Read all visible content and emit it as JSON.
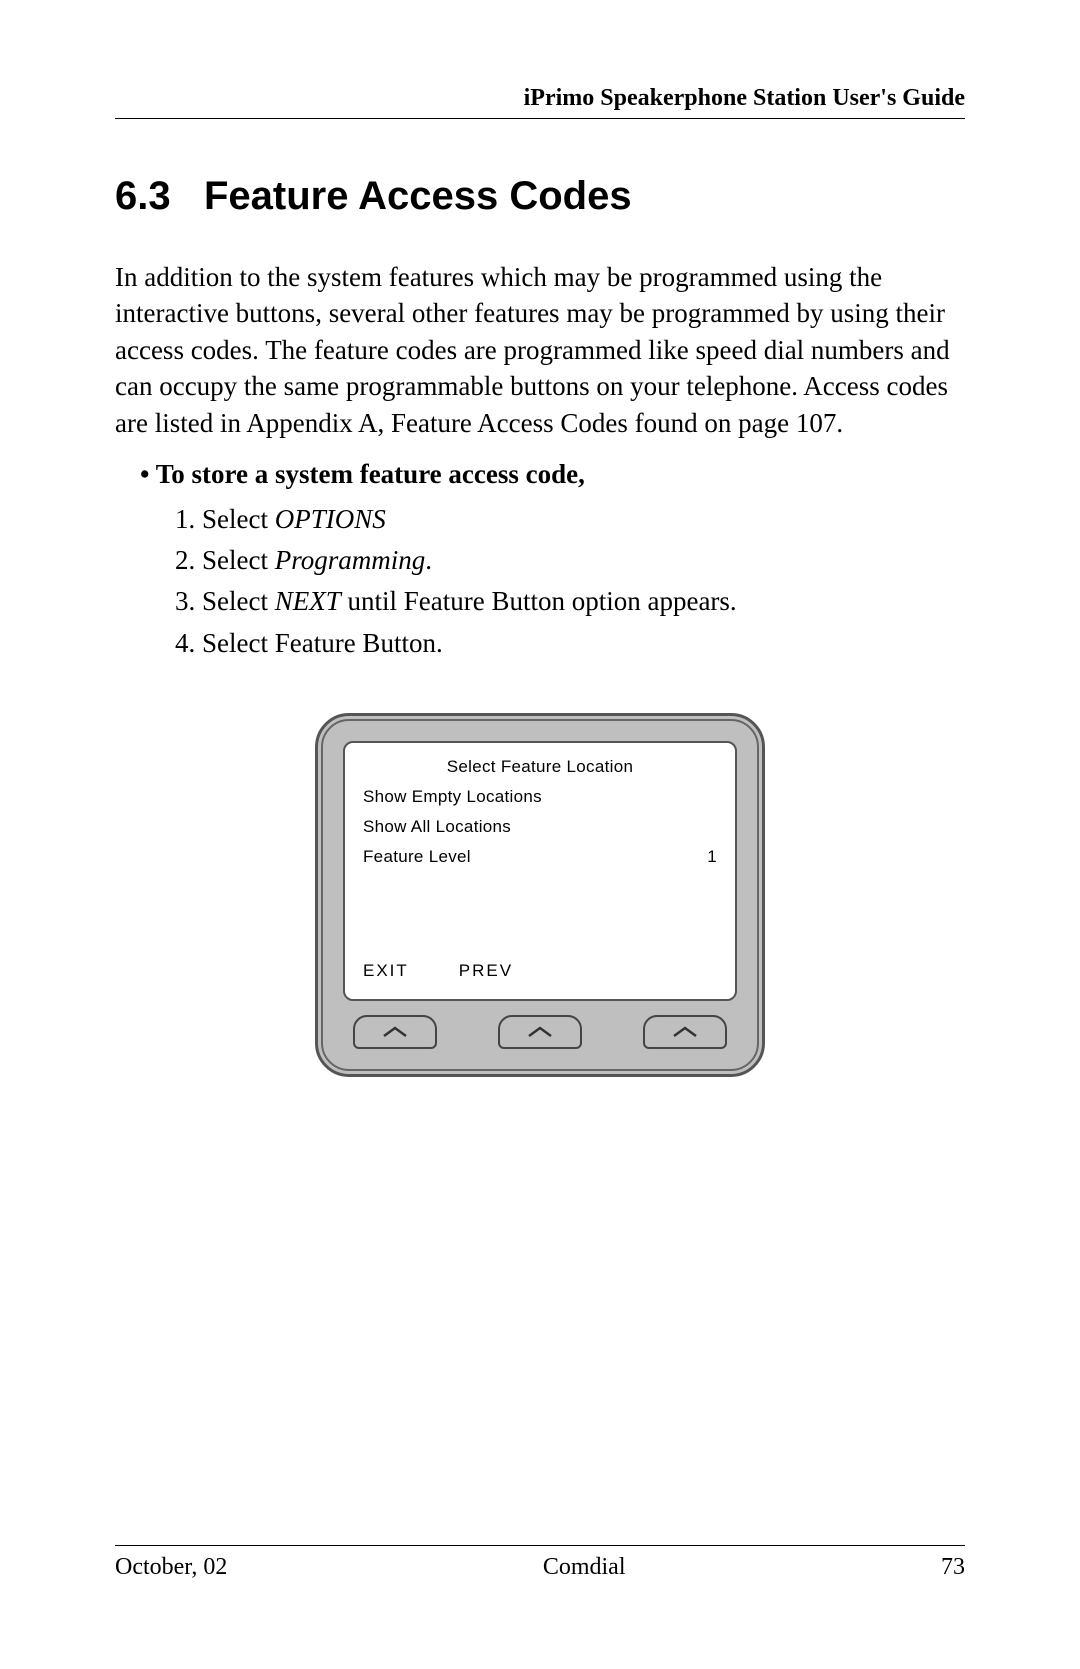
{
  "header": {
    "title": "iPrimo Speakerphone Station User's Guide"
  },
  "section": {
    "number": "6.3",
    "title": "Feature Access Codes"
  },
  "paragraph": "In addition to the system features which may be programmed using the interactive buttons, several other features may be programmed by using their access codes.  The feature codes are programmed like speed dial numbers and can occupy the same programmable buttons on your telephone.  Access codes are listed in Appendix A, Feature Access Codes found on page 107.",
  "bullet": {
    "text": "To store a system feature access code,"
  },
  "steps": [
    {
      "num": "1.",
      "prefix": "Select  ",
      "italic": "OPTIONS",
      "suffix": ""
    },
    {
      "num": "2.",
      "prefix": "Select ",
      "italic": "Programming",
      "suffix": "."
    },
    {
      "num": "3.",
      "prefix": "Select  ",
      "italic": "NEXT",
      "suffix": " until  Feature Button option appears."
    },
    {
      "num": "4.",
      "prefix": "Select  Feature Button.",
      "italic": "",
      "suffix": ""
    }
  ],
  "lcd": {
    "title": "Select Feature Location",
    "line1": "Show Empty Locations",
    "line2": "Show All Locations",
    "feature_label": "Feature Level",
    "feature_value": "1",
    "softkeys": {
      "left": "EXIT",
      "mid": "PREV"
    }
  },
  "footer": {
    "left": "October, 02",
    "center": "Comdial",
    "right": "73"
  }
}
